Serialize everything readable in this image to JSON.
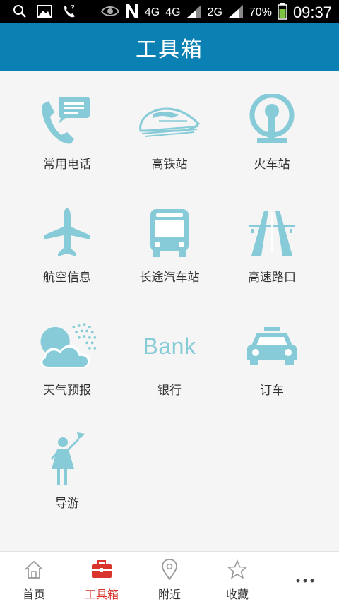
{
  "status_bar": {
    "network_1": "4G",
    "network_2": "4G",
    "network_3": "2G",
    "battery": "70%",
    "time": "09:37",
    "icons": [
      "search-icon",
      "image-icon",
      "phone-icon",
      "eye-icon",
      "n-icon",
      "signal-icon",
      "battery-icon"
    ]
  },
  "header": {
    "title": "工具箱"
  },
  "colors": {
    "accent": "#0a80b3",
    "icon": "#86cbd7",
    "active_tab": "#d9352c",
    "inactive_tab": "#999999"
  },
  "tools": [
    {
      "label": "常用电话",
      "icon": "phone-chat-icon"
    },
    {
      "label": "高铁站",
      "icon": "bullet-train-icon"
    },
    {
      "label": "火车站",
      "icon": "railway-logo-icon"
    },
    {
      "label": "航空信息",
      "icon": "airplane-icon"
    },
    {
      "label": "长途汽车站",
      "icon": "bus-icon"
    },
    {
      "label": "高速路口",
      "icon": "highway-icon"
    },
    {
      "label": "天气预报",
      "icon": "weather-icon"
    },
    {
      "label": "银行",
      "icon": "bank-icon",
      "icon_text": "Bank"
    },
    {
      "label": "订车",
      "icon": "taxi-icon"
    },
    {
      "label": "导游",
      "icon": "tour-guide-icon"
    }
  ],
  "tabs": [
    {
      "label": "首页",
      "icon": "home-icon"
    },
    {
      "label": "工具箱",
      "icon": "toolbox-icon",
      "active": true
    },
    {
      "label": "附近",
      "icon": "location-pin-icon"
    },
    {
      "label": "收藏",
      "icon": "star-icon"
    },
    {
      "label": "",
      "icon": "more-icon"
    }
  ]
}
